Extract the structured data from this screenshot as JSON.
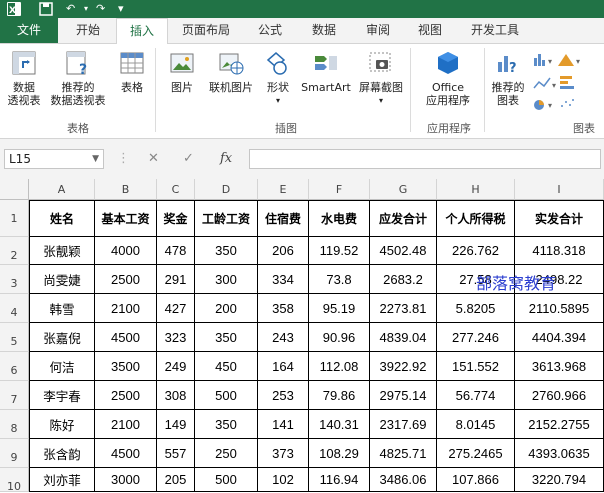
{
  "qat": {
    "undo": "↶",
    "redo": "↷",
    "more": "⋯"
  },
  "tabs": [
    "文件",
    "开始",
    "插入",
    "页面布局",
    "公式",
    "数据",
    "审阅",
    "视图",
    "开发工具"
  ],
  "ribbon": {
    "buttons": {
      "pivot": [
        "数据",
        "透视表"
      ],
      "recommended_pivot": [
        "推荐的",
        "数据透视表"
      ],
      "table": "表格",
      "pictures": "图片",
      "online_pictures": "联机图片",
      "shapes": "形状",
      "smartart": "SmartArt",
      "screenshot": "屏幕截图",
      "office_apps": [
        "Office",
        "应用程序"
      ],
      "recommended_charts": [
        "推荐的",
        "图表"
      ]
    },
    "groups": {
      "tables": "表格",
      "illustrations": "插图",
      "apps": "应用程序",
      "charts": "图表"
    }
  },
  "formula_bar": {
    "name_box": "L15",
    "cancel": "✕",
    "enter": "✓",
    "fx": "fx",
    "value": ""
  },
  "sheet": {
    "columns": [
      "A",
      "B",
      "C",
      "D",
      "E",
      "F",
      "G",
      "H",
      "I"
    ],
    "row_numbers": [
      "1",
      "2",
      "3",
      "4",
      "5",
      "6",
      "7",
      "8",
      "9",
      "10"
    ],
    "rows": [
      [
        "姓名",
        "基本工资",
        "奖金",
        "工龄工资",
        "住宿费",
        "水电费",
        "应发合计",
        "个人所得税",
        "实发合计"
      ],
      [
        "张靓颖",
        "4000",
        "478",
        "350",
        "206",
        "119.52",
        "4502.48",
        "226.762",
        "4118.318"
      ],
      [
        "尚雯婕",
        "2500",
        "291",
        "300",
        "334",
        "73.8",
        "2683.2",
        "27.58",
        "2498.22"
      ],
      [
        "韩雪",
        "2100",
        "427",
        "200",
        "358",
        "95.19",
        "2273.81",
        "5.8205",
        "2110.5895"
      ],
      [
        "张嘉倪",
        "4500",
        "323",
        "350",
        "243",
        "90.96",
        "4839.04",
        "277.246",
        "4404.394"
      ],
      [
        "何洁",
        "3500",
        "249",
        "450",
        "164",
        "112.08",
        "3922.92",
        "151.552",
        "3613.968"
      ],
      [
        "李宇春",
        "2500",
        "308",
        "500",
        "253",
        "79.86",
        "2975.14",
        "56.774",
        "2760.966"
      ],
      [
        "陈好",
        "2100",
        "149",
        "350",
        "141",
        "140.31",
        "2317.69",
        "8.0145",
        "2152.2755"
      ],
      [
        "张含韵",
        "4500",
        "557",
        "250",
        "373",
        "108.29",
        "4825.71",
        "275.2465",
        "4393.0635"
      ],
      [
        "刘亦菲",
        "3000",
        "205",
        "500",
        "102",
        "116.94",
        "3486.06",
        "107.866",
        "3220.794"
      ]
    ]
  },
  "watermark": "部落窝教育"
}
